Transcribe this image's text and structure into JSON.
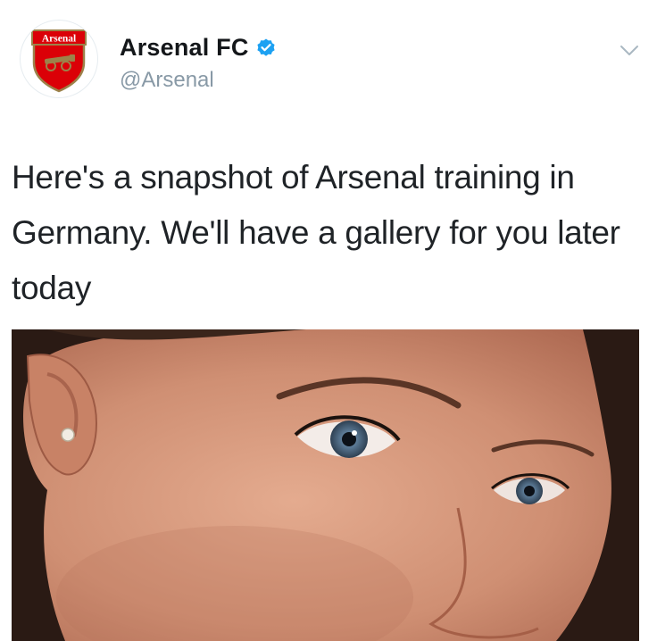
{
  "tweet": {
    "author": {
      "display_name": "Arsenal FC",
      "handle": "@Arsenal",
      "verified": true,
      "avatar_logo_text": "Arsenal",
      "avatar_icon": "arsenal-crest-icon"
    },
    "text": "Here's a snapshot of Arsenal training in Germany. We'll have a gallery for you later today",
    "menu_icon": "chevron-down-icon",
    "media": {
      "type": "photo",
      "icon": "photo"
    }
  },
  "colors": {
    "verified_blue": "#1da1f2",
    "crest_red": "#db0007",
    "crest_gold": "#9c824a",
    "handle_gray": "#8899a6",
    "text": "#1f2327"
  }
}
